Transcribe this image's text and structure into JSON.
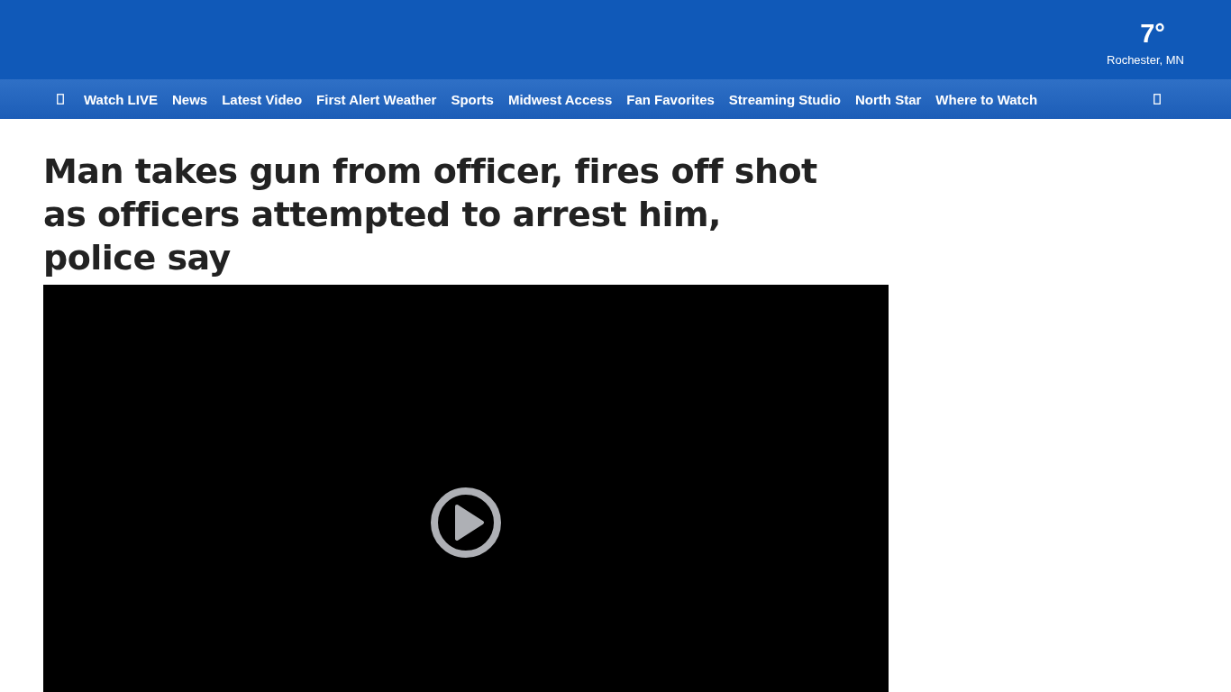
{
  "weather": {
    "temperature": "7°",
    "location": "Rochester, MN"
  },
  "nav": {
    "items": [
      {
        "label": "Watch LIVE"
      },
      {
        "label": "News"
      },
      {
        "label": "Latest Video"
      },
      {
        "label": "First Alert Weather"
      },
      {
        "label": "Sports"
      },
      {
        "label": "Midwest Access"
      },
      {
        "label": "Fan Favorites"
      },
      {
        "label": "Streaming Studio"
      },
      {
        "label": "North Star"
      },
      {
        "label": "Where to Watch"
      }
    ]
  },
  "article": {
    "headline": "Man takes gun from officer, fires off shot as officers attempted to arrest him, police say",
    "video": {
      "kind": "player"
    }
  }
}
